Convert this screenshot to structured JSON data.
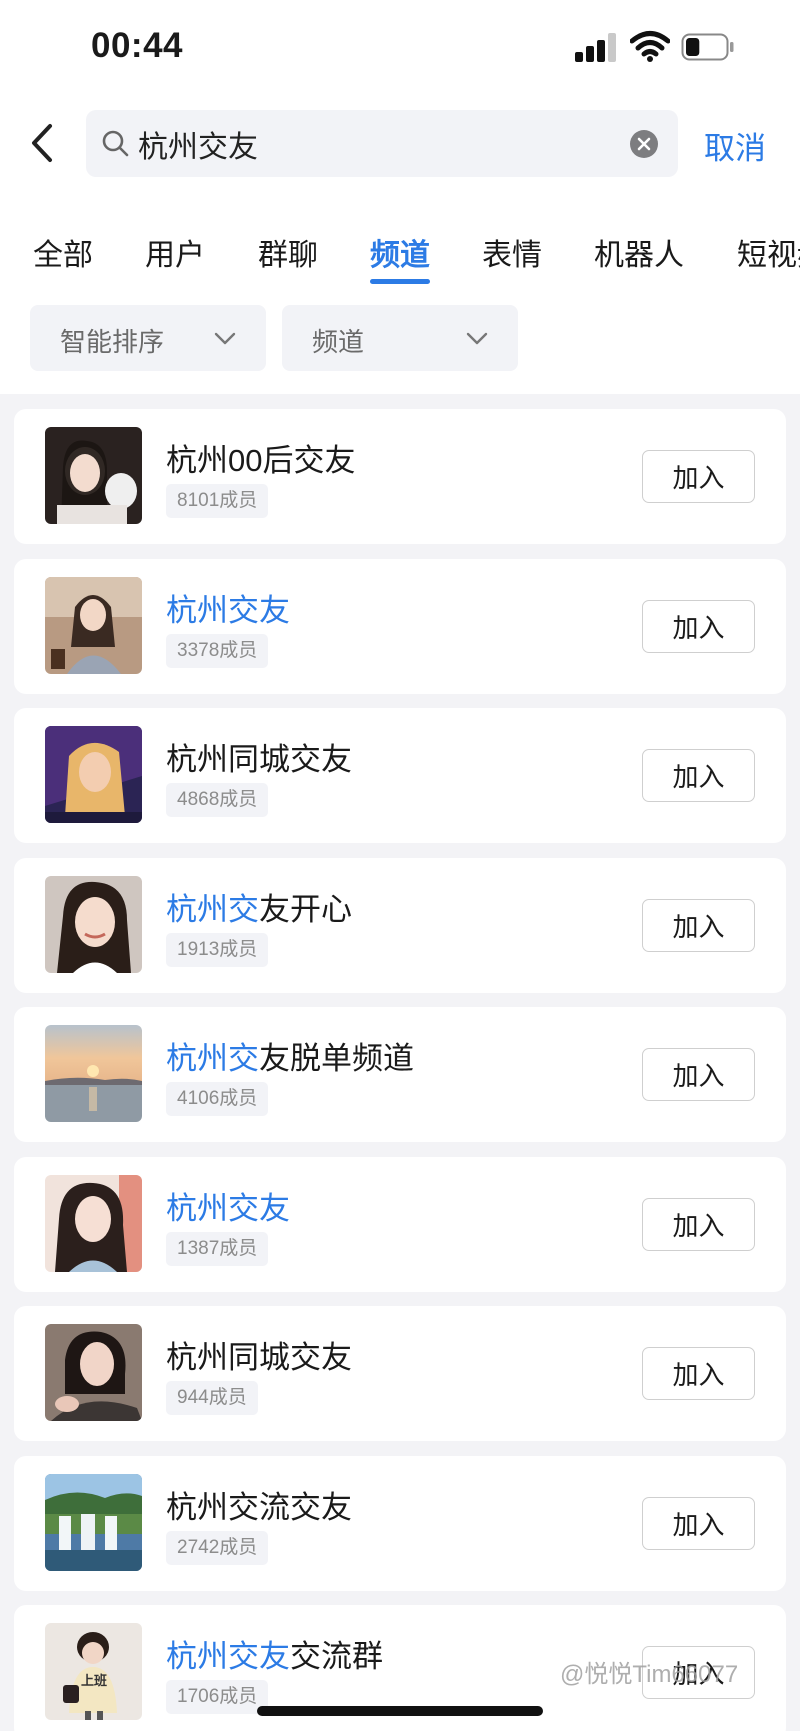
{
  "status_bar": {
    "time": "00:44",
    "battery_level": 0.35
  },
  "search": {
    "query": "杭州交友",
    "cancel_label": "取消"
  },
  "tabs": [
    {
      "label": "全部"
    },
    {
      "label": "用户"
    },
    {
      "label": "群聊"
    },
    {
      "label": "频道",
      "active": true
    },
    {
      "label": "表情"
    },
    {
      "label": "机器人"
    },
    {
      "label": "短视频"
    }
  ],
  "filters": [
    {
      "label": "智能排序"
    },
    {
      "label": "频道"
    }
  ],
  "results": [
    {
      "title": "杭州00后交友",
      "title_highlight": "",
      "title_rest": "杭州00后交友",
      "members": "8101成员",
      "button": "加入",
      "avatar_icon": "girl-with-dog-photo"
    },
    {
      "title": "杭州交友",
      "title_highlight": "杭州交友",
      "title_rest": "",
      "members": "3378成员",
      "button": "加入",
      "avatar_icon": "girl-portrait-photo"
    },
    {
      "title": "杭州同城交友",
      "title_highlight": "",
      "title_rest": "杭州同城交友",
      "members": "4868成员",
      "button": "加入",
      "avatar_icon": "girl-purple-photo"
    },
    {
      "title": "杭州交友开心",
      "title_highlight": "杭州交",
      "title_rest": "友开心",
      "members": "1913成员",
      "button": "加入",
      "avatar_icon": "girl-smile-photo"
    },
    {
      "title": "杭州交友脱单频道",
      "title_highlight": "杭州交",
      "title_rest": "友脱单频道",
      "members": "4106成员",
      "button": "加入",
      "avatar_icon": "sunset-lake-photo"
    },
    {
      "title": "杭州交友",
      "title_highlight": "杭州交友",
      "title_rest": "",
      "members": "1387成员",
      "button": "加入",
      "avatar_icon": "girl-long-hair-photo"
    },
    {
      "title": "杭州同城交友",
      "title_highlight": "",
      "title_rest": "杭州同城交友",
      "members": "944成员",
      "button": "加入",
      "avatar_icon": "girl-selfie-photo"
    },
    {
      "title": "杭州交流交友",
      "title_highlight": "",
      "title_rest": "杭州交流交友",
      "members": "2742成员",
      "button": "加入",
      "avatar_icon": "waterfall-photo"
    },
    {
      "title": "杭州交友交流群",
      "title_highlight": "杭州交友",
      "title_rest": "交流群",
      "members": "1706成员",
      "button": "加入",
      "avatar_icon": "cartoon-girl-photo",
      "badge_text": "上班"
    }
  ],
  "watermark": "@悦悦Tim66077",
  "colors": {
    "accent": "#2c7be5",
    "background": "#f3f3f6",
    "card": "#ffffff"
  }
}
